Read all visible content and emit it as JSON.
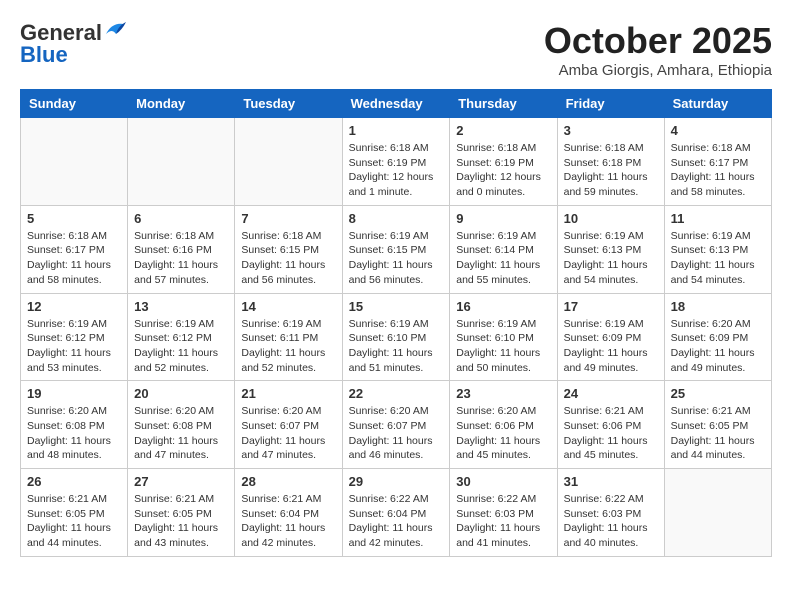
{
  "header": {
    "logo_line1": "General",
    "logo_line2": "Blue",
    "month_title": "October 2025",
    "subtitle": "Amba Giorgis, Amhara, Ethiopia"
  },
  "weekdays": [
    "Sunday",
    "Monday",
    "Tuesday",
    "Wednesday",
    "Thursday",
    "Friday",
    "Saturday"
  ],
  "weeks": [
    [
      {
        "day": "",
        "info": ""
      },
      {
        "day": "",
        "info": ""
      },
      {
        "day": "",
        "info": ""
      },
      {
        "day": "1",
        "info": "Sunrise: 6:18 AM\nSunset: 6:19 PM\nDaylight: 12 hours\nand 1 minute."
      },
      {
        "day": "2",
        "info": "Sunrise: 6:18 AM\nSunset: 6:19 PM\nDaylight: 12 hours\nand 0 minutes."
      },
      {
        "day": "3",
        "info": "Sunrise: 6:18 AM\nSunset: 6:18 PM\nDaylight: 11 hours\nand 59 minutes."
      },
      {
        "day": "4",
        "info": "Sunrise: 6:18 AM\nSunset: 6:17 PM\nDaylight: 11 hours\nand 58 minutes."
      }
    ],
    [
      {
        "day": "5",
        "info": "Sunrise: 6:18 AM\nSunset: 6:17 PM\nDaylight: 11 hours\nand 58 minutes."
      },
      {
        "day": "6",
        "info": "Sunrise: 6:18 AM\nSunset: 6:16 PM\nDaylight: 11 hours\nand 57 minutes."
      },
      {
        "day": "7",
        "info": "Sunrise: 6:18 AM\nSunset: 6:15 PM\nDaylight: 11 hours\nand 56 minutes."
      },
      {
        "day": "8",
        "info": "Sunrise: 6:19 AM\nSunset: 6:15 PM\nDaylight: 11 hours\nand 56 minutes."
      },
      {
        "day": "9",
        "info": "Sunrise: 6:19 AM\nSunset: 6:14 PM\nDaylight: 11 hours\nand 55 minutes."
      },
      {
        "day": "10",
        "info": "Sunrise: 6:19 AM\nSunset: 6:13 PM\nDaylight: 11 hours\nand 54 minutes."
      },
      {
        "day": "11",
        "info": "Sunrise: 6:19 AM\nSunset: 6:13 PM\nDaylight: 11 hours\nand 54 minutes."
      }
    ],
    [
      {
        "day": "12",
        "info": "Sunrise: 6:19 AM\nSunset: 6:12 PM\nDaylight: 11 hours\nand 53 minutes."
      },
      {
        "day": "13",
        "info": "Sunrise: 6:19 AM\nSunset: 6:12 PM\nDaylight: 11 hours\nand 52 minutes."
      },
      {
        "day": "14",
        "info": "Sunrise: 6:19 AM\nSunset: 6:11 PM\nDaylight: 11 hours\nand 52 minutes."
      },
      {
        "day": "15",
        "info": "Sunrise: 6:19 AM\nSunset: 6:10 PM\nDaylight: 11 hours\nand 51 minutes."
      },
      {
        "day": "16",
        "info": "Sunrise: 6:19 AM\nSunset: 6:10 PM\nDaylight: 11 hours\nand 50 minutes."
      },
      {
        "day": "17",
        "info": "Sunrise: 6:19 AM\nSunset: 6:09 PM\nDaylight: 11 hours\nand 49 minutes."
      },
      {
        "day": "18",
        "info": "Sunrise: 6:20 AM\nSunset: 6:09 PM\nDaylight: 11 hours\nand 49 minutes."
      }
    ],
    [
      {
        "day": "19",
        "info": "Sunrise: 6:20 AM\nSunset: 6:08 PM\nDaylight: 11 hours\nand 48 minutes."
      },
      {
        "day": "20",
        "info": "Sunrise: 6:20 AM\nSunset: 6:08 PM\nDaylight: 11 hours\nand 47 minutes."
      },
      {
        "day": "21",
        "info": "Sunrise: 6:20 AM\nSunset: 6:07 PM\nDaylight: 11 hours\nand 47 minutes."
      },
      {
        "day": "22",
        "info": "Sunrise: 6:20 AM\nSunset: 6:07 PM\nDaylight: 11 hours\nand 46 minutes."
      },
      {
        "day": "23",
        "info": "Sunrise: 6:20 AM\nSunset: 6:06 PM\nDaylight: 11 hours\nand 45 minutes."
      },
      {
        "day": "24",
        "info": "Sunrise: 6:21 AM\nSunset: 6:06 PM\nDaylight: 11 hours\nand 45 minutes."
      },
      {
        "day": "25",
        "info": "Sunrise: 6:21 AM\nSunset: 6:05 PM\nDaylight: 11 hours\nand 44 minutes."
      }
    ],
    [
      {
        "day": "26",
        "info": "Sunrise: 6:21 AM\nSunset: 6:05 PM\nDaylight: 11 hours\nand 44 minutes."
      },
      {
        "day": "27",
        "info": "Sunrise: 6:21 AM\nSunset: 6:05 PM\nDaylight: 11 hours\nand 43 minutes."
      },
      {
        "day": "28",
        "info": "Sunrise: 6:21 AM\nSunset: 6:04 PM\nDaylight: 11 hours\nand 42 minutes."
      },
      {
        "day": "29",
        "info": "Sunrise: 6:22 AM\nSunset: 6:04 PM\nDaylight: 11 hours\nand 42 minutes."
      },
      {
        "day": "30",
        "info": "Sunrise: 6:22 AM\nSunset: 6:03 PM\nDaylight: 11 hours\nand 41 minutes."
      },
      {
        "day": "31",
        "info": "Sunrise: 6:22 AM\nSunset: 6:03 PM\nDaylight: 11 hours\nand 40 minutes."
      },
      {
        "day": "",
        "info": ""
      }
    ]
  ]
}
